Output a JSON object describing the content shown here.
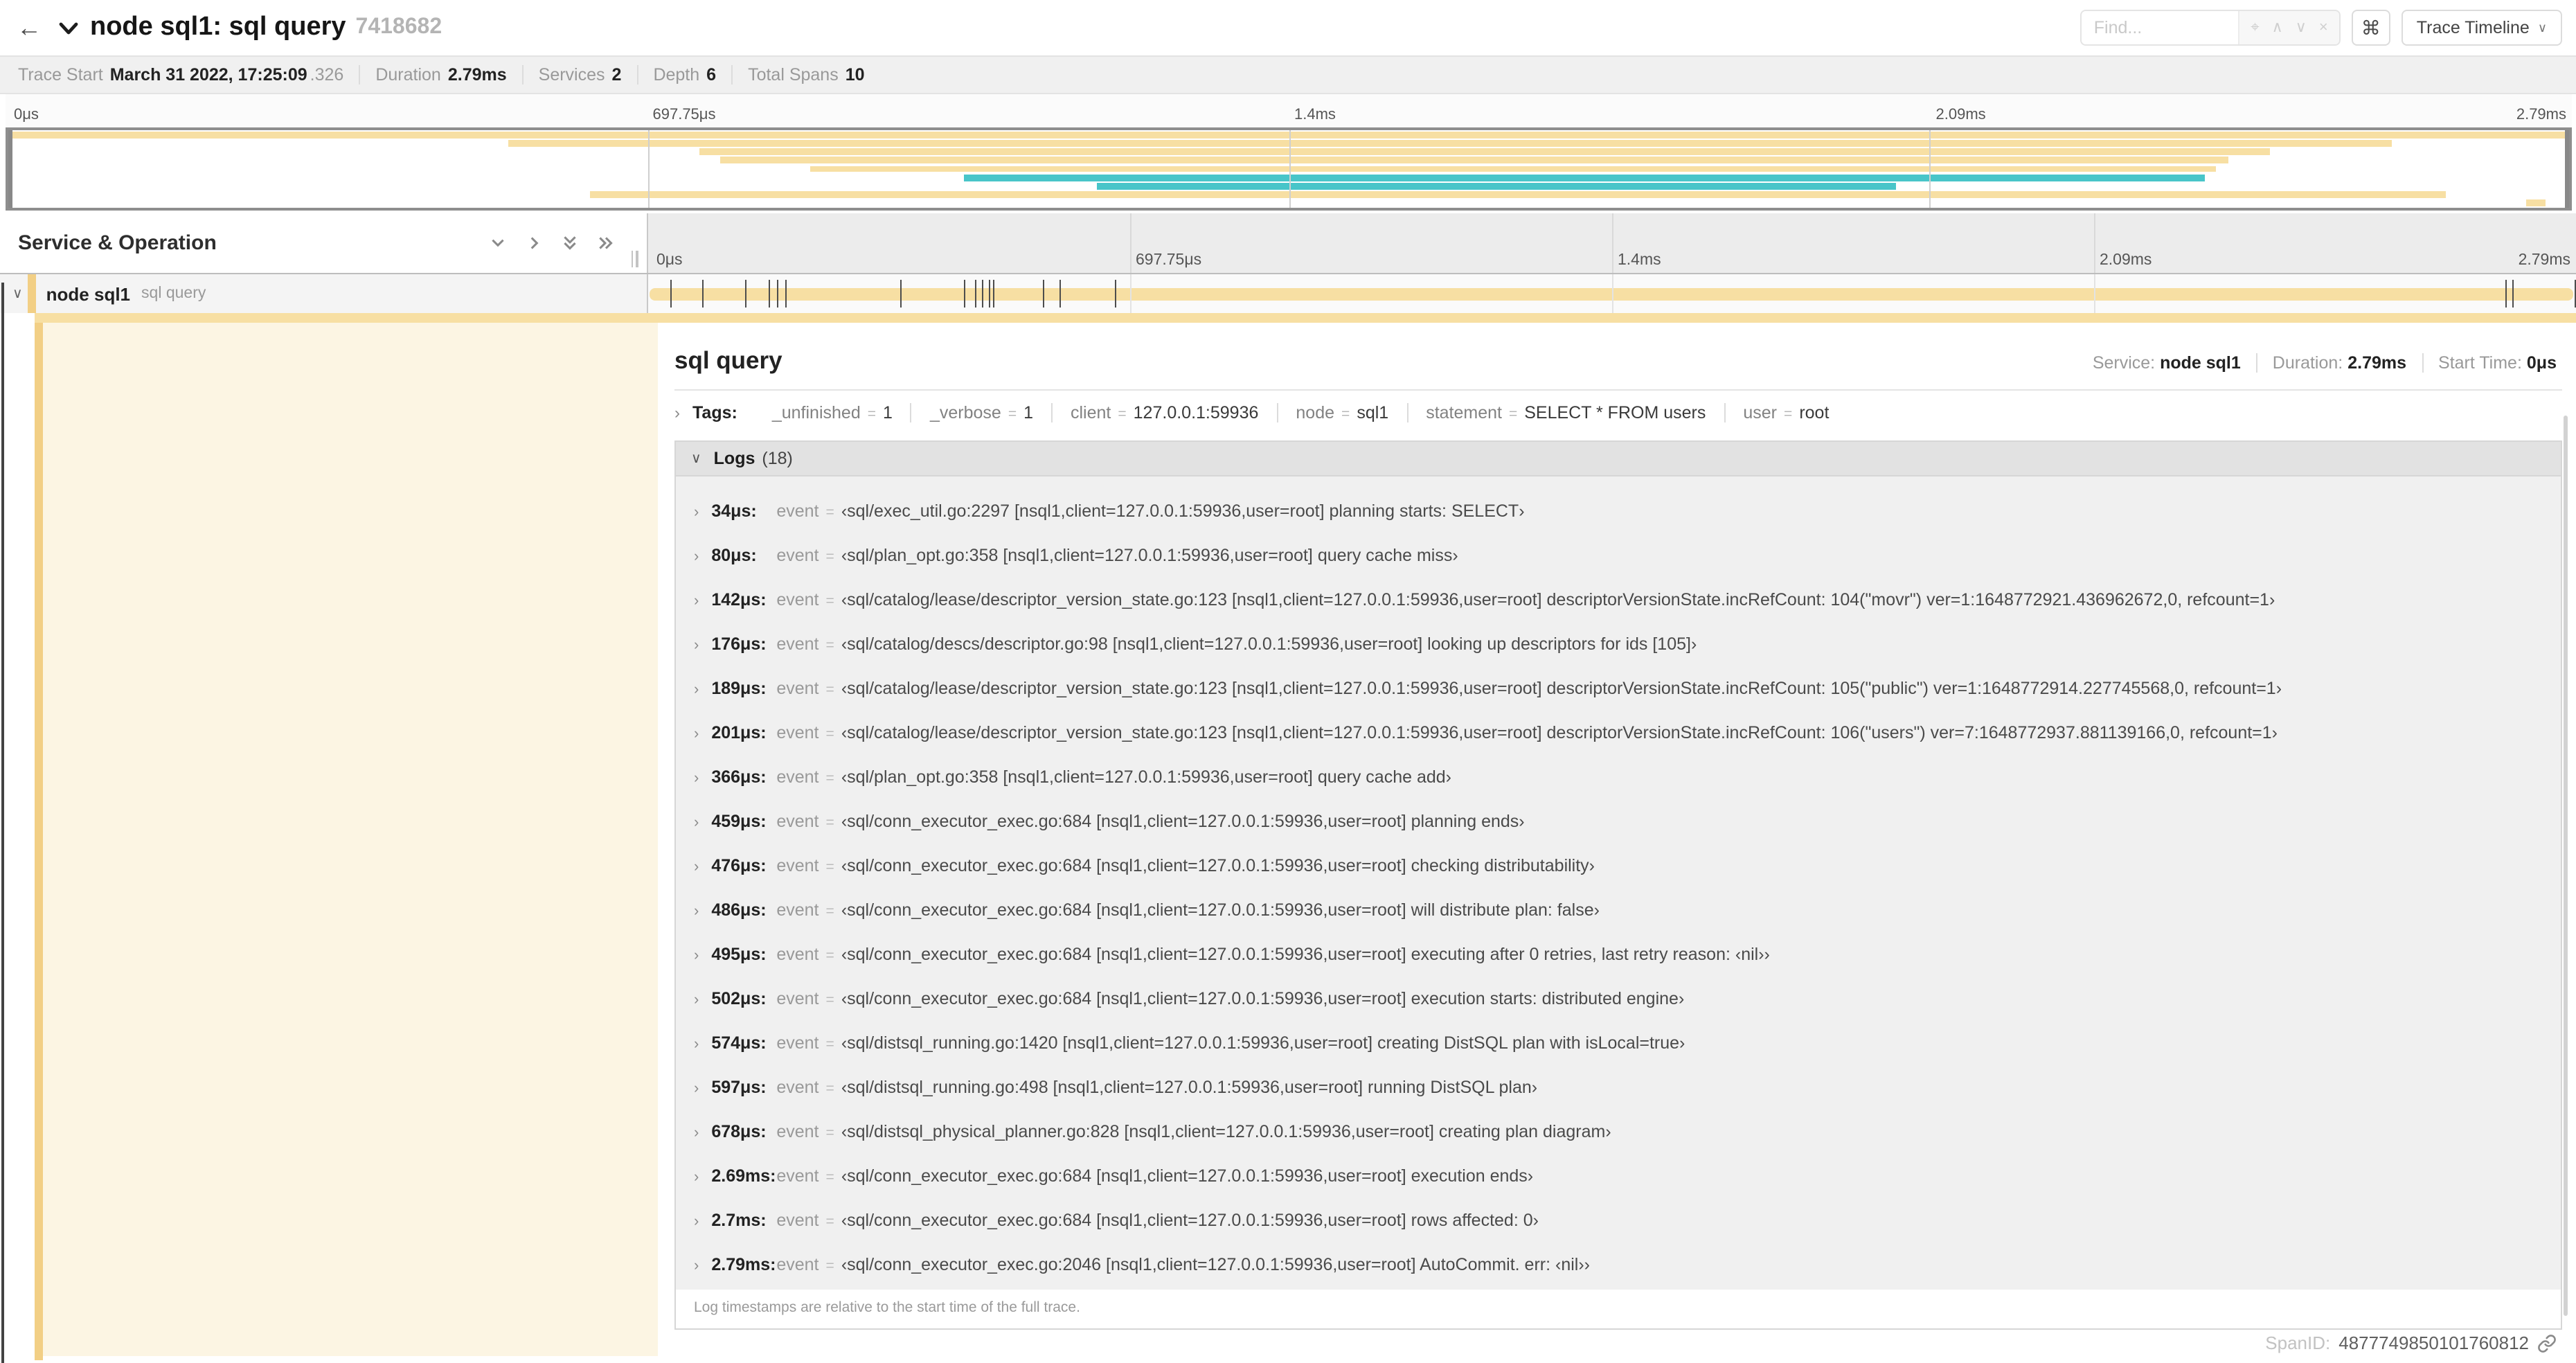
{
  "header": {
    "back_glyph": "←",
    "title": "node sql1: sql query",
    "trace_id_short": "7418682",
    "find_placeholder": "Find...",
    "find_controls": [
      {
        "name": "locate",
        "glyph": "⌖"
      },
      {
        "name": "previous-match",
        "glyph": "∧"
      },
      {
        "name": "next-match",
        "glyph": "∨"
      },
      {
        "name": "clear-search",
        "glyph": "×"
      }
    ],
    "shortcut_glyph": "⌘",
    "view_button": "Trace Timeline"
  },
  "trace_info": {
    "items": [
      {
        "label": "Trace Start",
        "value": "March 31 2022, 17:25:09",
        "suffix": ".326"
      },
      {
        "label": "Duration",
        "value": "2.79ms"
      },
      {
        "label": "Services",
        "value": "2"
      },
      {
        "label": "Depth",
        "value": "6"
      },
      {
        "label": "Total Spans",
        "value": "10"
      }
    ]
  },
  "timeline": {
    "duration_us": 2790,
    "ticks": [
      {
        "label": "0μs",
        "pct": 0
      },
      {
        "label": "697.75μs",
        "pct": 25
      },
      {
        "label": "1.4ms",
        "pct": 50
      },
      {
        "label": "2.09ms",
        "pct": 75
      },
      {
        "label": "2.79ms",
        "pct": 100
      }
    ]
  },
  "minimap": {
    "palette": {
      "span_yellow": "#f7dfa3",
      "span_teal": "#48c5c9"
    },
    "rows": [
      {
        "color": "span_yellow",
        "start": 0,
        "end": 100
      },
      {
        "color": "span_yellow",
        "start": 19.5,
        "end": 93.1
      },
      {
        "color": "span_yellow",
        "start": 27.0,
        "end": 88.3
      },
      {
        "color": "span_yellow",
        "start": 27.8,
        "end": 86.7
      },
      {
        "color": "span_yellow",
        "start": 31.3,
        "end": 86.2
      },
      {
        "color": "span_teal",
        "start": 37.3,
        "end": 85.8
      },
      {
        "color": "span_teal",
        "start": 42.5,
        "end": 73.7
      },
      {
        "color": "span_yellow",
        "start": 22.7,
        "end": 95.2
      },
      {
        "color": "span_yellow",
        "start": 98.3,
        "end": 99.1
      }
    ]
  },
  "left_header": {
    "title": "Service & Operation"
  },
  "span_row": {
    "service": "node sql1",
    "operation": "sql query"
  },
  "detail": {
    "title": "sql query",
    "summary": [
      {
        "label": "Service:",
        "value": "node sql1"
      },
      {
        "label": "Duration:",
        "value": "2.79ms"
      },
      {
        "label": "Start Time:",
        "value": "0μs"
      }
    ],
    "tags_label": "Tags:",
    "tags": [
      {
        "key": "_unfinished",
        "value": "1"
      },
      {
        "key": "_verbose",
        "value": "1"
      },
      {
        "key": "client",
        "value": "127.0.0.1:59936"
      },
      {
        "key": "node",
        "value": "sql1"
      },
      {
        "key": "statement",
        "value": "SELECT * FROM users"
      },
      {
        "key": "user",
        "value": "root"
      }
    ],
    "logs_label": "Logs",
    "logs_count": "(18)",
    "logs": [
      {
        "t": "34μs:",
        "us": 34,
        "key": "event",
        "value": "‹sql/exec_util.go:2297 [nsql1,client=127.0.0.1:59936,user=root] planning starts: SELECT›"
      },
      {
        "t": "80μs:",
        "us": 80,
        "key": "event",
        "value": "‹sql/plan_opt.go:358 [nsql1,client=127.0.0.1:59936,user=root] query cache miss›"
      },
      {
        "t": "142μs:",
        "us": 142,
        "key": "event",
        "value": "‹sql/catalog/lease/descriptor_version_state.go:123 [nsql1,client=127.0.0.1:59936,user=root] descriptorVersionState.incRefCount: 104(\"movr\") ver=1:1648772921.436962672,0, refcount=1›"
      },
      {
        "t": "176μs:",
        "us": 176,
        "key": "event",
        "value": "‹sql/catalog/descs/descriptor.go:98 [nsql1,client=127.0.0.1:59936,user=root] looking up descriptors for ids [105]›"
      },
      {
        "t": "189μs:",
        "us": 189,
        "key": "event",
        "value": "‹sql/catalog/lease/descriptor_version_state.go:123 [nsql1,client=127.0.0.1:59936,user=root] descriptorVersionState.incRefCount: 105(\"public\") ver=1:1648772914.227745568,0, refcount=1›"
      },
      {
        "t": "201μs:",
        "us": 201,
        "key": "event",
        "value": "‹sql/catalog/lease/descriptor_version_state.go:123 [nsql1,client=127.0.0.1:59936,user=root] descriptorVersionState.incRefCount: 106(\"users\") ver=7:1648772937.881139166,0, refcount=1›"
      },
      {
        "t": "366μs:",
        "us": 366,
        "key": "event",
        "value": "‹sql/plan_opt.go:358 [nsql1,client=127.0.0.1:59936,user=root] query cache add›"
      },
      {
        "t": "459μs:",
        "us": 459,
        "key": "event",
        "value": "‹sql/conn_executor_exec.go:684 [nsql1,client=127.0.0.1:59936,user=root] planning ends›"
      },
      {
        "t": "476μs:",
        "us": 476,
        "key": "event",
        "value": "‹sql/conn_executor_exec.go:684 [nsql1,client=127.0.0.1:59936,user=root] checking distributability›"
      },
      {
        "t": "486μs:",
        "us": 486,
        "key": "event",
        "value": "‹sql/conn_executor_exec.go:684 [nsql1,client=127.0.0.1:59936,user=root] will distribute plan: false›"
      },
      {
        "t": "495μs:",
        "us": 495,
        "key": "event",
        "value": "‹sql/conn_executor_exec.go:684 [nsql1,client=127.0.0.1:59936,user=root] executing after 0 retries, last retry reason: ‹nil››"
      },
      {
        "t": "502μs:",
        "us": 502,
        "key": "event",
        "value": "‹sql/conn_executor_exec.go:684 [nsql1,client=127.0.0.1:59936,user=root] execution starts: distributed engine›"
      },
      {
        "t": "574μs:",
        "us": 574,
        "key": "event",
        "value": "‹sql/distsql_running.go:1420 [nsql1,client=127.0.0.1:59936,user=root] creating DistSQL plan with isLocal=true›"
      },
      {
        "t": "597μs:",
        "us": 597,
        "key": "event",
        "value": "‹sql/distsql_running.go:498 [nsql1,client=127.0.0.1:59936,user=root] running DistSQL plan›"
      },
      {
        "t": "678μs:",
        "us": 678,
        "key": "event",
        "value": "‹sql/distsql_physical_planner.go:828 [nsql1,client=127.0.0.1:59936,user=root] creating plan diagram›"
      },
      {
        "t": "2.69ms:",
        "us": 2690,
        "key": "event",
        "value": "‹sql/conn_executor_exec.go:684 [nsql1,client=127.0.0.1:59936,user=root] execution ends›"
      },
      {
        "t": "2.7ms:",
        "us": 2700,
        "key": "event",
        "value": "‹sql/conn_executor_exec.go:684 [nsql1,client=127.0.0.1:59936,user=root] rows affected: 0›"
      },
      {
        "t": "2.79ms:",
        "us": 2790,
        "key": "event",
        "value": "‹sql/conn_executor_exec.go:2046 [nsql1,client=127.0.0.1:59936,user=root] AutoCommit. err: ‹nil››"
      }
    ],
    "logs_footer": "Log timestamps are relative to the start time of the full trace.",
    "span_id_label": "SpanID:",
    "span_id": "4877749850101760812"
  }
}
